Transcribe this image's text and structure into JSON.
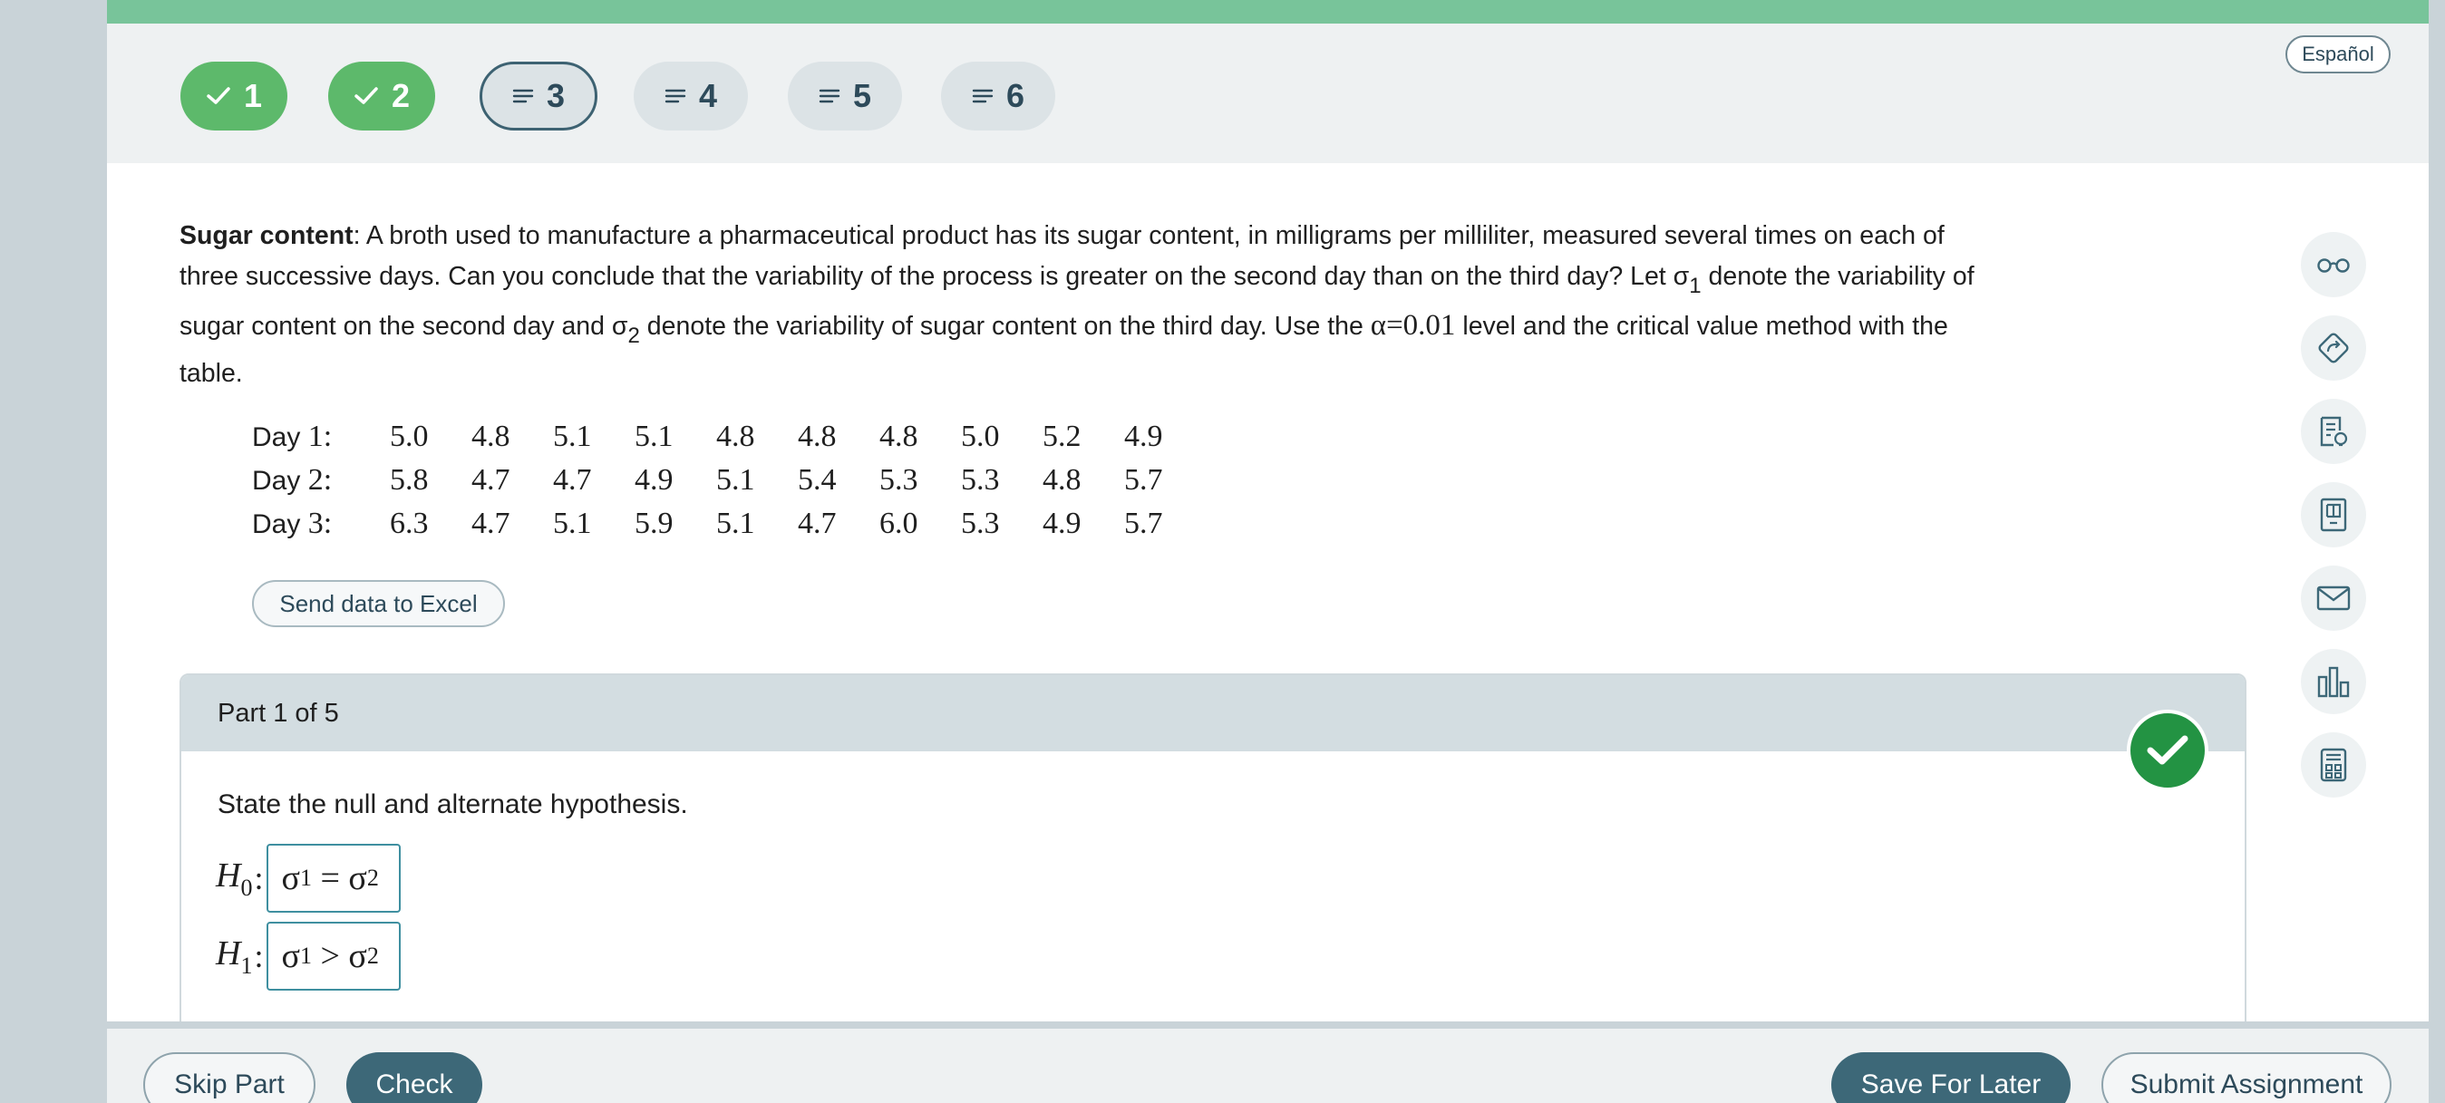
{
  "nav": {
    "questions": [
      {
        "label": "1",
        "status": "complete",
        "icon": "check-icon"
      },
      {
        "label": "2",
        "status": "complete",
        "icon": "check-icon"
      },
      {
        "label": "3",
        "status": "current",
        "icon": "lines-icon"
      },
      {
        "label": "4",
        "status": "incomplete",
        "icon": "lines-icon"
      },
      {
        "label": "5",
        "status": "incomplete",
        "icon": "lines-icon"
      },
      {
        "label": "6",
        "status": "incomplete",
        "icon": "lines-icon"
      }
    ],
    "language_button": "Español"
  },
  "problem": {
    "title": "Sugar content",
    "l1": ": A broth used to manufacture a pharmaceutical product has its sugar content, in milligrams per milliliter, measured several times on each of",
    "l2a": "three successive days. Can you conclude that the variability of the process is greater on the second day than on the third day? Let σ",
    "l2sub": "1",
    "l2b": " denote the variability of",
    "l3a": "sugar content on the second day and σ",
    "l3sub": "2",
    "l3b": " denote the variability of sugar content on the third day. Use the ",
    "alpha": "α=0.01",
    "l3c": " level and the critical value method with the",
    "l4": "table."
  },
  "data_table": {
    "rows": [
      {
        "label_word": "Day",
        "label_num": "1:",
        "values": [
          "5.0",
          "4.8",
          "5.1",
          "5.1",
          "4.8",
          "4.8",
          "4.8",
          "5.0",
          "5.2",
          "4.9"
        ]
      },
      {
        "label_word": "Day",
        "label_num": "2:",
        "values": [
          "5.8",
          "4.7",
          "4.7",
          "4.9",
          "5.1",
          "5.4",
          "5.3",
          "5.3",
          "4.8",
          "5.7"
        ]
      },
      {
        "label_word": "Day",
        "label_num": "3:",
        "values": [
          "6.3",
          "4.7",
          "5.1",
          "5.9",
          "5.1",
          "4.7",
          "6.0",
          "5.3",
          "4.9",
          "5.7"
        ]
      }
    ]
  },
  "excel_button": "Send data to Excel",
  "part": {
    "header": "Part 1 of 5",
    "prompt": "State the null and alternate hypothesis.",
    "h0": {
      "label": "H",
      "label_sub": "0",
      "colon": ":",
      "left": "σ",
      "left_sub": "1",
      "op": " = ",
      "right": "σ",
      "right_sub": "2"
    },
    "h1": {
      "label": "H",
      "label_sub": "1",
      "colon": ":",
      "left": "σ",
      "left_sub": "1",
      "op": " > ",
      "right": "σ",
      "right_sub": "2"
    }
  },
  "sidebar_tools": [
    "glasses-icon",
    "hint-icon",
    "notes-icon",
    "ebook-icon",
    "mail-icon",
    "chart-icon",
    "calculator-icon"
  ],
  "footer": {
    "skip": "Skip Part",
    "check": "Check",
    "save": "Save For Later",
    "submit": "Submit Assignment"
  },
  "colors": {
    "complete_green": "#5db96b",
    "correct_badge": "#239343",
    "primary_button": "#3d6878",
    "top_strip": "#78c49a"
  }
}
